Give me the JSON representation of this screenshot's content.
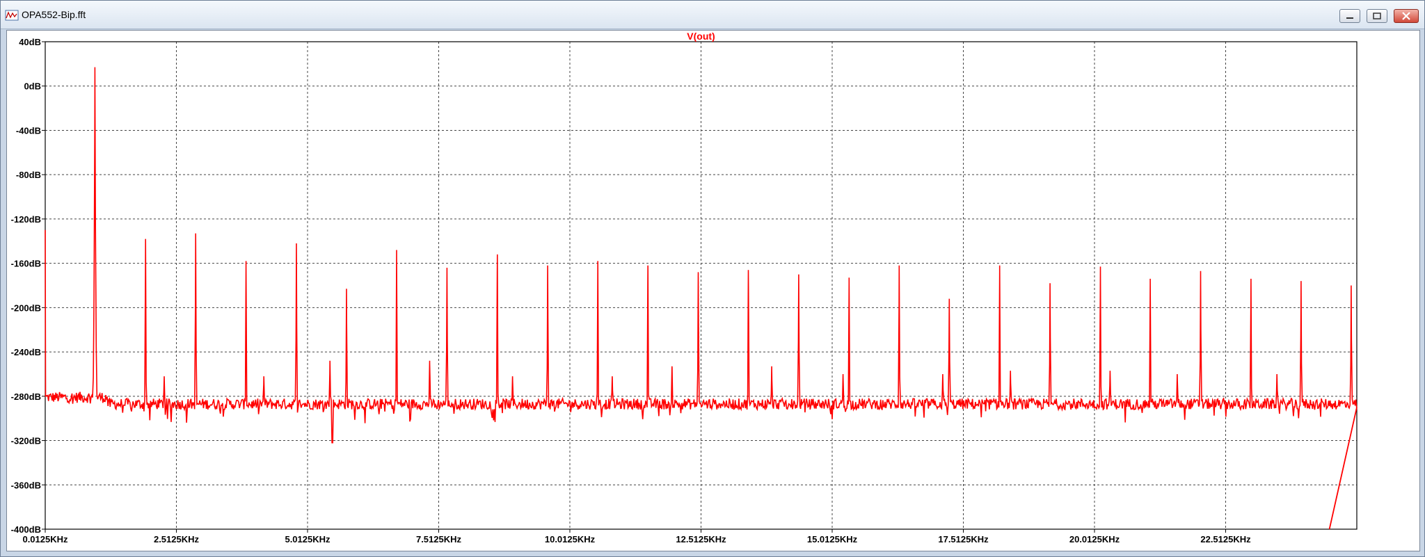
{
  "window": {
    "title": "OPA552-Bip.fft",
    "buttons": [
      "minimize",
      "maximize",
      "close"
    ],
    "icon": "waveform-app-icon"
  },
  "chart_data": {
    "type": "line",
    "title": "V(out)",
    "line_color": "#ff0000",
    "grid": true,
    "grid_style": "dashed",
    "xlim": [
      12.5,
      25012.5
    ],
    "ylim": [
      -400,
      40
    ],
    "xticks": [
      "0.0125KHz",
      "2.5125KHz",
      "5.0125KHz",
      "7.5125KHz",
      "10.0125KHz",
      "12.5125KHz",
      "15.0125KHz",
      "17.5125KHz",
      "20.0125KHz",
      "22.5125KHz"
    ],
    "xtick_values": [
      12.5,
      2512.5,
      5012.5,
      7512.5,
      10012.5,
      12512.5,
      15012.5,
      17512.5,
      20012.5,
      22512.5
    ],
    "yticks": [
      "40dB",
      "0dB",
      "-40dB",
      "-80dB",
      "-120dB",
      "-160dB",
      "-200dB",
      "-240dB",
      "-280dB",
      "-320dB",
      "-360dB",
      "-400dB"
    ],
    "ytick_values": [
      40,
      0,
      -40,
      -80,
      -120,
      -160,
      -200,
      -240,
      -280,
      -320,
      -360,
      -400
    ],
    "noise_floor_db": -287,
    "fundamental": {
      "x": 960,
      "y": 17
    },
    "harmonics": [
      {
        "x": 1925,
        "y": -138
      },
      {
        "x": 2880,
        "y": -133
      },
      {
        "x": 3840,
        "y": -158
      },
      {
        "x": 4800,
        "y": -142
      },
      {
        "x": 5755,
        "y": -183
      },
      {
        "x": 6710,
        "y": -148
      },
      {
        "x": 7670,
        "y": -164
      },
      {
        "x": 8630,
        "y": -152
      },
      {
        "x": 9590,
        "y": -162
      },
      {
        "x": 10545,
        "y": -158
      },
      {
        "x": 11500,
        "y": -162
      },
      {
        "x": 12460,
        "y": -168
      },
      {
        "x": 13415,
        "y": -166
      },
      {
        "x": 14375,
        "y": -170
      },
      {
        "x": 15335,
        "y": -173
      },
      {
        "x": 16290,
        "y": -162
      },
      {
        "x": 17245,
        "y": -192
      },
      {
        "x": 18205,
        "y": -162
      },
      {
        "x": 19165,
        "y": -178
      },
      {
        "x": 20125,
        "y": -163
      },
      {
        "x": 21075,
        "y": -174
      },
      {
        "x": 22035,
        "y": -167
      },
      {
        "x": 22995,
        "y": -174
      },
      {
        "x": 23950,
        "y": -176
      },
      {
        "x": 24905,
        "y": -180
      }
    ],
    "minor_spurs": [
      {
        "x": 2280,
        "y": -262
      },
      {
        "x": 4180,
        "y": -262
      },
      {
        "x": 5440,
        "y": -248
      },
      {
        "x": 7340,
        "y": -248
      },
      {
        "x": 8920,
        "y": -262
      },
      {
        "x": 10820,
        "y": -262
      },
      {
        "x": 11960,
        "y": -253
      },
      {
        "x": 13860,
        "y": -253
      },
      {
        "x": 15220,
        "y": -260
      },
      {
        "x": 17120,
        "y": -260
      },
      {
        "x": 18410,
        "y": -257
      },
      {
        "x": 20310,
        "y": -257
      },
      {
        "x": 21590,
        "y": -260
      },
      {
        "x": 23490,
        "y": -260
      }
    ],
    "dips": [
      {
        "x": 5480,
        "y": -322
      }
    ],
    "edge_segment": {
      "x_start": 24490,
      "y_start": -400,
      "x_end": 25012.5,
      "y_end": -290
    }
  }
}
